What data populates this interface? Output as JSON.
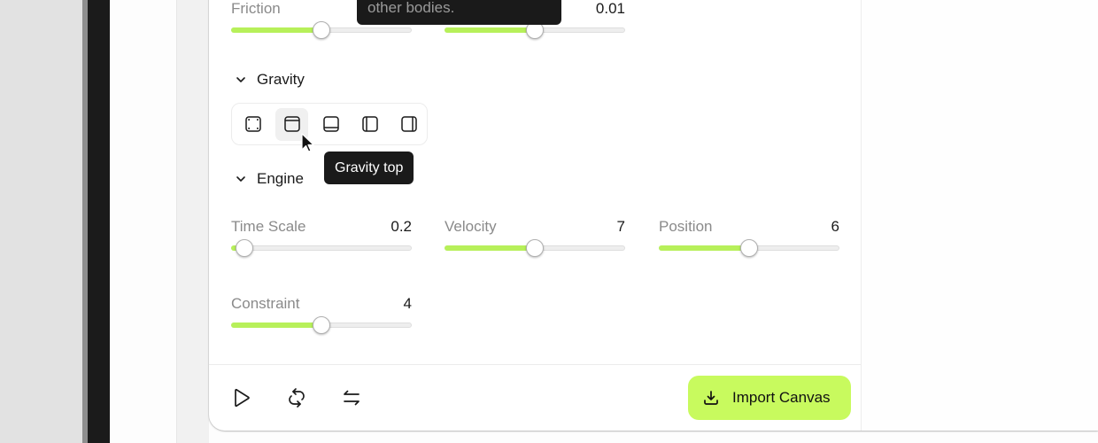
{
  "colors": {
    "accent": "#c8fa5e",
    "slider_fill": "#b7f05a",
    "tooltip_bg": "#1a1a1a"
  },
  "sliders_top": [
    {
      "label": "Friction",
      "value": "",
      "fraction": 0.5
    },
    {
      "label": "",
      "value": "0.01",
      "fraction": 0.5
    }
  ],
  "tooltip_top": {
    "text": "other bodies."
  },
  "gravity": {
    "title": "Gravity",
    "buttons": [
      {
        "icon": "gravity-none-icon",
        "label": "Gravity none"
      },
      {
        "icon": "gravity-top-icon",
        "label": "Gravity top",
        "active": true
      },
      {
        "icon": "gravity-bottom-icon",
        "label": "Gravity bottom"
      },
      {
        "icon": "gravity-left-icon",
        "label": "Gravity left"
      },
      {
        "icon": "gravity-right-icon",
        "label": "Gravity right"
      }
    ],
    "tooltip": "Gravity top"
  },
  "engine": {
    "title": "Engine",
    "sliders": [
      {
        "label": "Time Scale",
        "value": "0.2",
        "fraction": 0.07
      },
      {
        "label": "Velocity",
        "value": "7",
        "fraction": 0.5
      },
      {
        "label": "Position",
        "value": "6",
        "fraction": 0.5
      },
      {
        "label": "Constraint",
        "value": "4",
        "fraction": 0.5
      }
    ]
  },
  "footer": {
    "play_icon": "play-icon",
    "loop_icon": "repeat-icon",
    "swap_icon": "swap-arrows-icon",
    "import_label": "Import Canvas",
    "import_icon": "download-icon"
  }
}
